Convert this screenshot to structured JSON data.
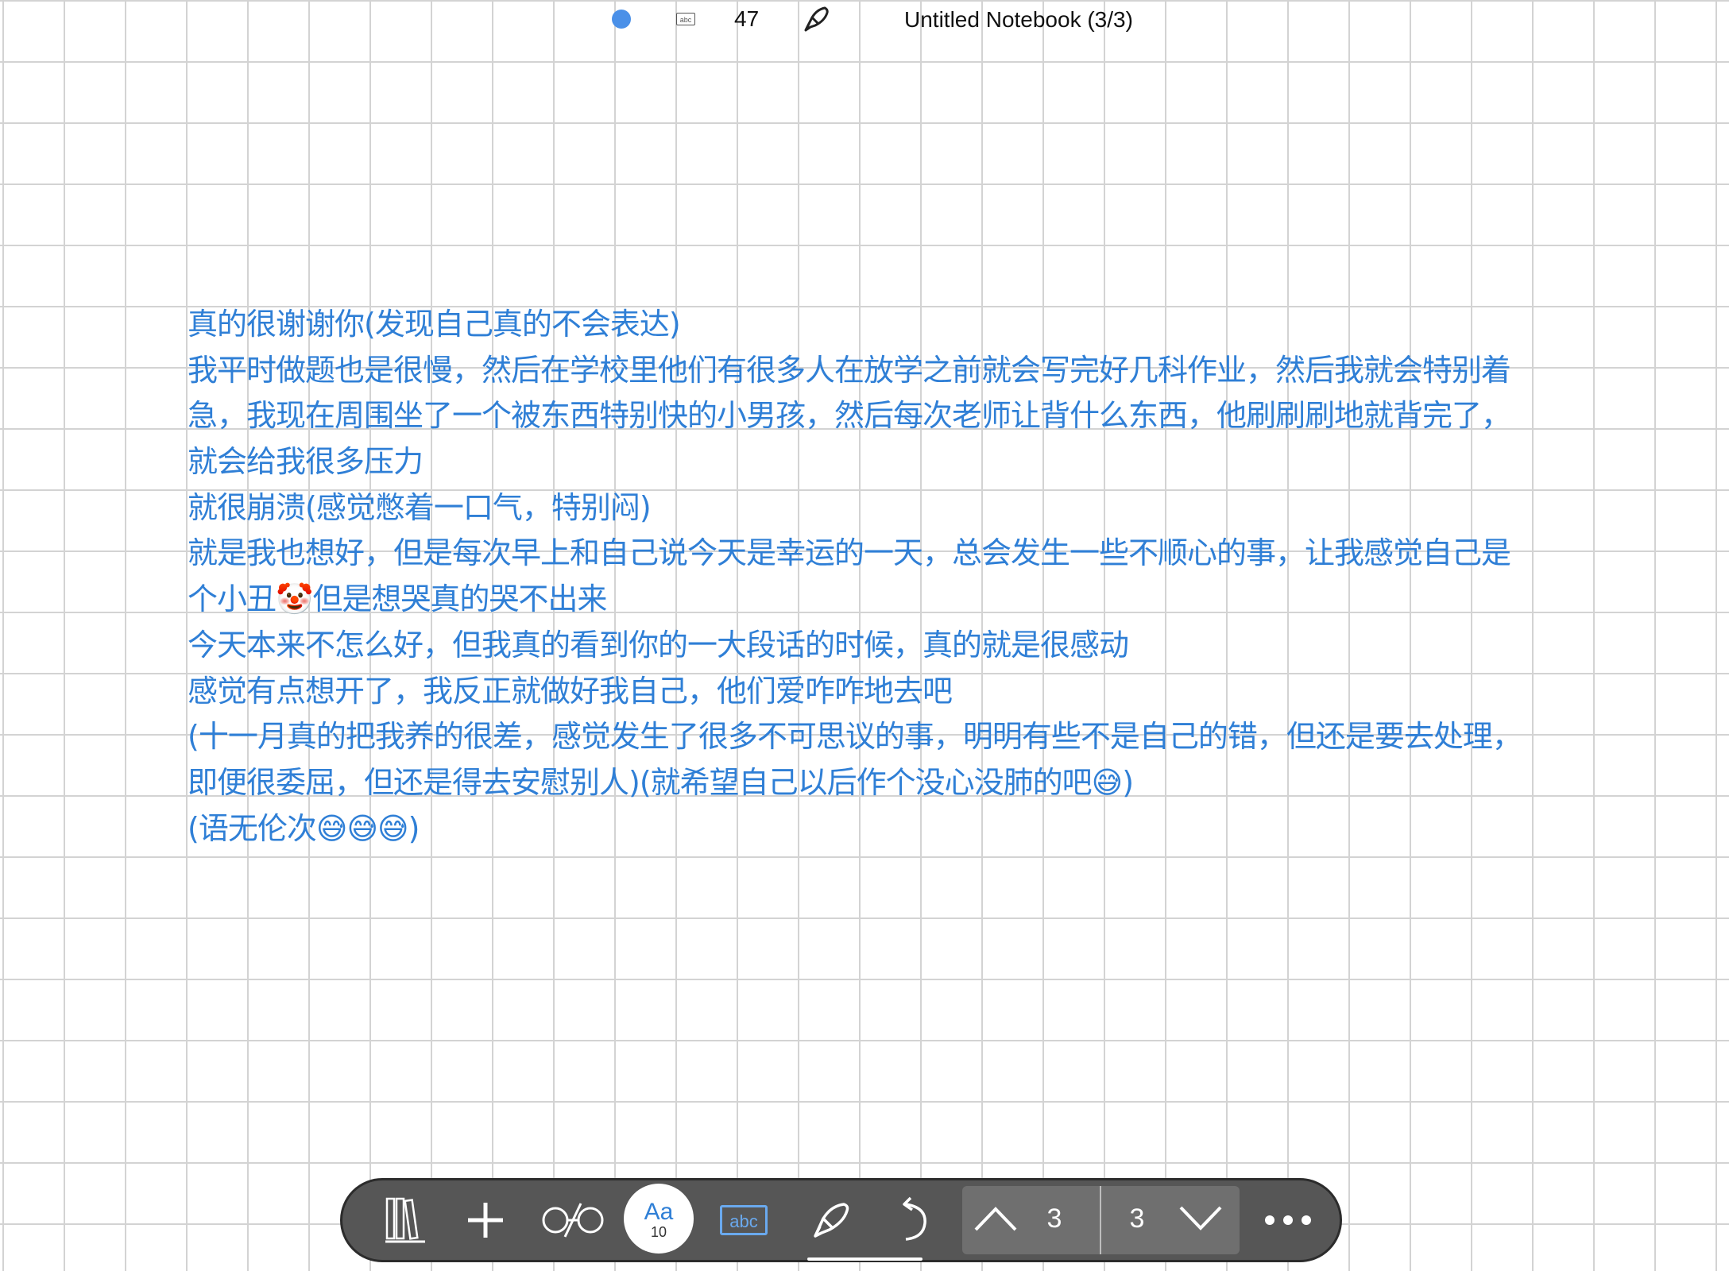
{
  "status_bar": {
    "dot_color": "#4a90e8",
    "mode_icon_label": "abc",
    "word_count": "47",
    "title": "Untitled Notebook (3/3)"
  },
  "note": {
    "text_color": "#2f7fd6",
    "lines": [
      "真的很谢谢你(发现自己真的不会表达)",
      "我平时做题也是很慢，然后在学校里他们有很多人在放学之前就会写完好几科作业，然后我就会特别着",
      "急，我现在周围坐了一个被东西特别快的小男孩，然后每次老师让背什么东西，他刷刷刷地就背完了，",
      "就会给我很多压力",
      "就很崩溃(感觉憋着一口气，特别闷)",
      "就是我也想好，但是每次早上和自己说今天是幸运的一天，总会发生一些不顺心的事，让我感觉自己是",
      "个小丑🤡但是想哭真的哭不出来",
      "今天本来不怎么好，但我真的看到你的一大段话的时候，真的就是很感动",
      "感觉有点想开了，我反正就做好我自己，他们爱咋咋地去吧",
      "(十一月真的把我养的很差，感觉发生了很多不可思议的事，明明有些不是自己的错，但还是要去处理，",
      "即便很委屈，但还是得去安慰别人)(就希望自己以后作个没心没肺的吧😅)",
      "(语无伦次😅😅😅)"
    ]
  },
  "toolbar": {
    "library_icon": "library-icon",
    "add_icon": "plus-icon",
    "search_icon": "glasses-icon",
    "font_label": "Aa",
    "font_size": "10",
    "abc_label": "abc",
    "pen_icon": "pen-icon",
    "undo_icon": "undo-icon",
    "current_page": "3",
    "total_pages": "3",
    "more_icon": "more-icon",
    "accent_color": "#6aa9ee"
  }
}
